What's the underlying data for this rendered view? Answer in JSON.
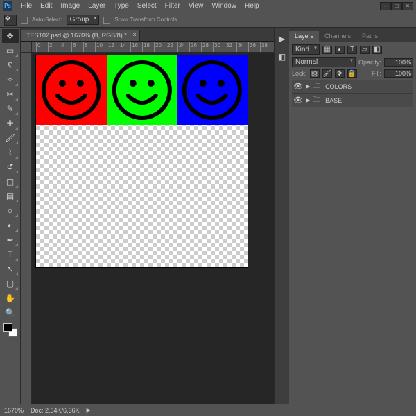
{
  "app": {
    "logo": "Ps"
  },
  "menu": [
    "File",
    "Edit",
    "Image",
    "Layer",
    "Type",
    "Select",
    "Filter",
    "View",
    "Window",
    "Help"
  ],
  "options": {
    "auto_select_label": "Auto-Select:",
    "auto_select_mode": "Group",
    "show_transform_label": "Show Transform Controls"
  },
  "document": {
    "tab_title": "TEST02.psd @ 1670% (B, RGB/8) *",
    "ruler_ticks": [
      "0",
      "2",
      "4",
      "6",
      "8",
      "10",
      "12",
      "14",
      "16",
      "18",
      "20",
      "22",
      "24",
      "26",
      "28",
      "30",
      "32",
      "34",
      "36",
      "38"
    ],
    "colors": {
      "red": "#ff0000",
      "green": "#00ff00",
      "blue": "#0000ff"
    }
  },
  "panels": {
    "tabs": [
      "Layers",
      "Channels",
      "Paths"
    ],
    "kind_label": "Kind",
    "blend_mode": "Normal",
    "opacity_label": "Opacity:",
    "opacity_value": "100%",
    "lock_label": "Lock:",
    "fill_label": "Fill:",
    "fill_value": "100%",
    "layers": [
      {
        "name": "COLORS"
      },
      {
        "name": "BASE"
      }
    ]
  },
  "status": {
    "zoom": "1670%",
    "doc_info": "Doc: 2,64K/6,36K"
  }
}
